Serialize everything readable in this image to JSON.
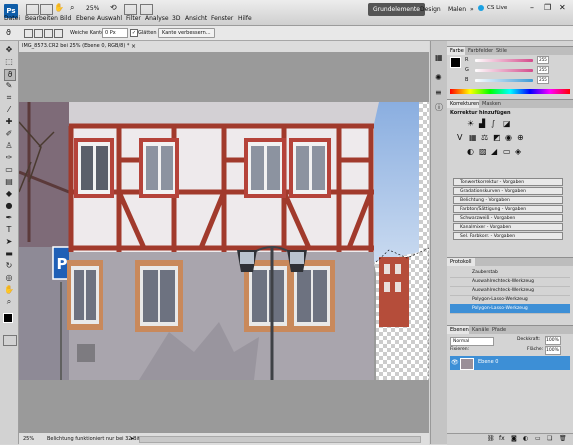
{
  "menubar": {
    "logo": "Ps",
    "items": [
      "Datei",
      "Bearbeiten",
      "Bild",
      "Ebene",
      "Auswahl",
      "Filter",
      "Analyse",
      "3D",
      "Ansicht",
      "Fenster",
      "Hilfe"
    ],
    "zoom": "25%",
    "workspace_active": "Grundelemente",
    "workspace_others": [
      "Design",
      "Malen"
    ],
    "cs_live": "CS Live"
  },
  "options": {
    "weiche_kante_label": "Weiche Kante:",
    "weiche_kante_value": "0 Px",
    "glaetten_label": "Glätten",
    "kante_button": "Kante verbessern..."
  },
  "document": {
    "tab_title": "IMG_8573.CR2 bei 25% (Ebene 0, RGB/8) *",
    "status_zoom": "25%",
    "status_text": "Belichtung funktioniert nur bei 32-Bit"
  },
  "color_panel": {
    "tabs": [
      "Farbe",
      "Farbfelder",
      "Stile"
    ],
    "rgb_values": [
      "255",
      "255",
      "255"
    ],
    "channel_colors": [
      "#d44a8b",
      "#d44a8b",
      "#3a9ad6"
    ]
  },
  "adjust_panel": {
    "tabs": [
      "Korrekturen",
      "Masken"
    ],
    "heading": "Korrektur hinzufügen",
    "presets": [
      "Tonwertkorrektur - Vorgaben",
      "Gradationskurven - Vorgaben",
      "Belichtung - Vorgaben",
      "Farbton/Sättigung - Vorgaben",
      "Schwarzweiß - Vorgaben",
      "Kanalmixer - Vorgaben",
      "Sel. Farbkorr. - Vorgaben"
    ]
  },
  "history_panel": {
    "tab": "Protokoll",
    "items": [
      "Zauberstab",
      "Auswahlrechteck-Werkzeug",
      "Auswahlrechteck-Werkzeug",
      "Polygon-Lasso-Werkzeug",
      "Polygon-Lasso-Werkzeug"
    ],
    "selected_index": 4
  },
  "layers_panel": {
    "tabs": [
      "Ebenen",
      "Kanäle",
      "Pfade"
    ],
    "blend_mode": "Normal",
    "opacity_label": "Deckkraft:",
    "opacity_value": "100%",
    "fill_label": "Fläche:",
    "fill_value": "100%",
    "lock_label": "Fixieren:",
    "layer_name": "Ebene 0",
    "accent": "#3d8fd6"
  }
}
